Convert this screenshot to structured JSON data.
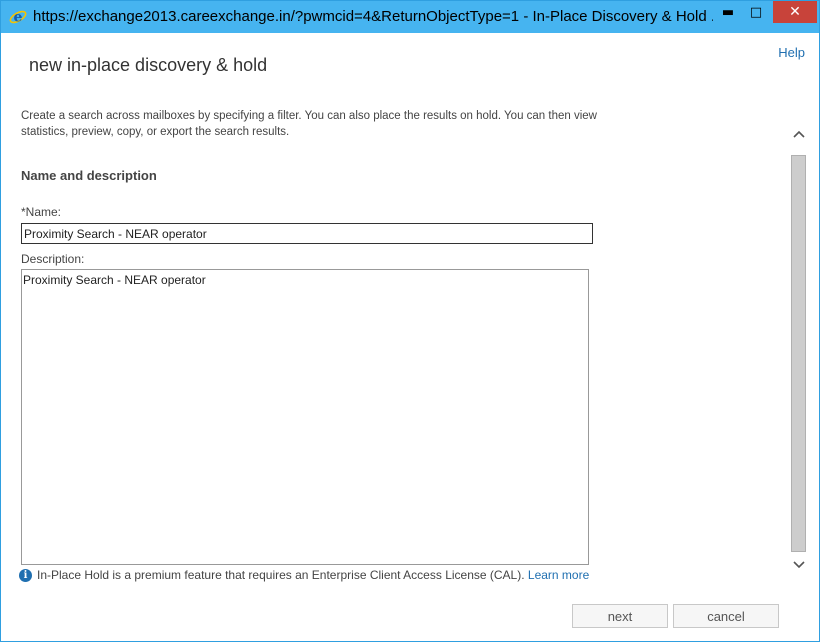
{
  "window": {
    "title": "https://exchange2013.careexchange.in/?pwmcid=4&ReturnObjectType=1 - In-Place Discovery & Hold ...",
    "minimize_glyph": "▬",
    "maximize_glyph": "□",
    "close_glyph": "✕",
    "icon": "internet-explorer-icon"
  },
  "header": {
    "help": "Help",
    "title": "new in-place discovery & hold"
  },
  "intro": "Create a search across mailboxes by specifying a filter. You can also place the results on hold. You can then view statistics, preview, copy, or export the search results.",
  "section": {
    "heading": "Name and description"
  },
  "form": {
    "name_label": "*Name:",
    "name_value": "Proximity Search - NEAR operator",
    "description_label": "Description:",
    "description_value": "Proximity Search - NEAR operator"
  },
  "notice": {
    "icon_glyph": "i",
    "text": "In-Place Hold is a premium feature that requires an Enterprise Client Access License (CAL).",
    "link": "Learn more"
  },
  "buttons": {
    "next": "next",
    "cancel": "cancel"
  },
  "colors": {
    "titlebar": "#46b4f0",
    "close_button": "#c8433a",
    "link": "#1f6fb0"
  }
}
